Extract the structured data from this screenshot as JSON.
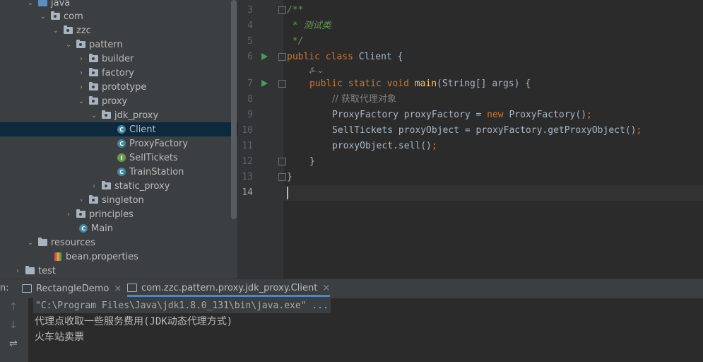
{
  "project_tree": {
    "items": [
      {
        "label": "java",
        "kind": "folder-java"
      },
      {
        "label": "com",
        "kind": "package"
      },
      {
        "label": "zzc",
        "kind": "package"
      },
      {
        "label": "pattern",
        "kind": "package"
      },
      {
        "label": "builder",
        "kind": "package"
      },
      {
        "label": "factory",
        "kind": "package"
      },
      {
        "label": "prototype",
        "kind": "package"
      },
      {
        "label": "proxy",
        "kind": "package"
      },
      {
        "label": "jdk_proxy",
        "kind": "package"
      },
      {
        "label": "Client",
        "kind": "class",
        "icon_letter": "C",
        "selected": true
      },
      {
        "label": "ProxyFactory",
        "kind": "class",
        "icon_letter": "C"
      },
      {
        "label": "SellTickets",
        "kind": "interface",
        "icon_letter": "I"
      },
      {
        "label": "TrainStation",
        "kind": "class",
        "icon_letter": "C"
      },
      {
        "label": "static_proxy",
        "kind": "package"
      },
      {
        "label": "singleton",
        "kind": "package"
      },
      {
        "label": "principles",
        "kind": "package"
      },
      {
        "label": "Main",
        "kind": "class",
        "icon_letter": "C"
      },
      {
        "label": "resources",
        "kind": "folder-resources"
      },
      {
        "label": "bean.properties",
        "kind": "properties"
      },
      {
        "label": "test",
        "kind": "folder"
      }
    ]
  },
  "editor": {
    "line_numbers": [
      "3",
      "4",
      "5",
      "6",
      "7",
      "8",
      "9",
      "10",
      "11",
      "12",
      "13",
      "14"
    ],
    "current_line": "14",
    "code": {
      "l3": "/**",
      "l4_star": " * ",
      "l4_text": "测试类",
      "l5": " */",
      "l6_kw1": "public",
      "l6_kw2": "class",
      "l6_name": "Client {",
      "hint_icon": "⍼⌄",
      "l7_kw1": "public",
      "l7_kw2": "static",
      "l7_kw3": "void",
      "l7_fn": "main",
      "l7_rest": "(String[] args) {",
      "l8": "// 获取代理对象",
      "l9_a": "ProxyFactory proxyFactory = ",
      "l9_kw": "new",
      "l9_b": " ProxyFactory()",
      "l10": "SellTickets proxyObject = proxyFactory.getProxyObject()",
      "l11": "proxyObject.sell()",
      "semi": ";",
      "l12": "}",
      "l13": "}"
    }
  },
  "run_panel": {
    "label": "n:",
    "tabs": [
      {
        "label": "RectangleDemo",
        "close": "×"
      },
      {
        "label": "com.zzc.pattern.proxy.jdk_proxy.Client",
        "close": "×",
        "active": true
      }
    ],
    "side_buttons": [
      "↑",
      "↓",
      "⇌"
    ],
    "command_line": "\"C:\\Program Files\\Java\\jdk1.8.0_131\\bin\\java.exe\" ...",
    "output": [
      "代理点收取一些服务费用(JDK动态代理方式)",
      "火车站卖票"
    ]
  }
}
